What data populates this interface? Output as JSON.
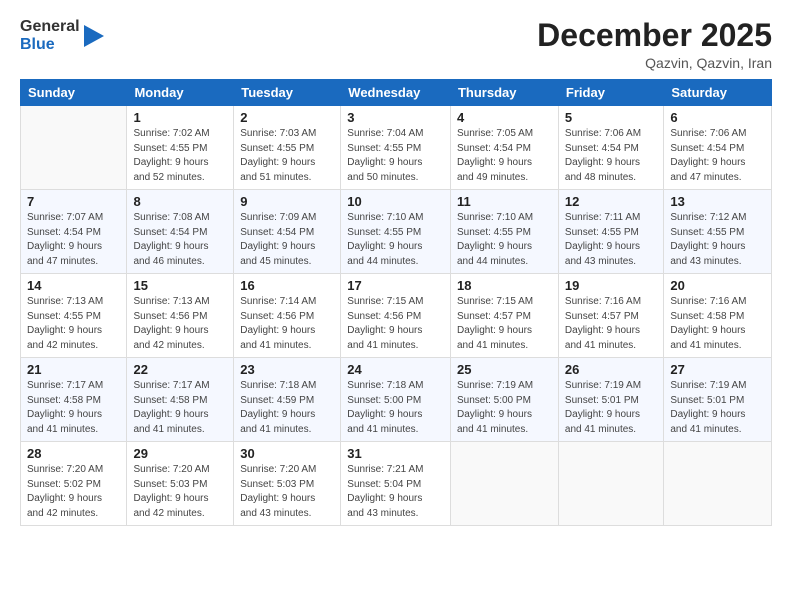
{
  "logo": {
    "general": "General",
    "blue": "Blue"
  },
  "header": {
    "month": "December 2025",
    "location": "Qazvin, Qazvin, Iran"
  },
  "weekdays": [
    "Sunday",
    "Monday",
    "Tuesday",
    "Wednesday",
    "Thursday",
    "Friday",
    "Saturday"
  ],
  "weeks": [
    [
      {
        "day": "",
        "info": ""
      },
      {
        "day": "1",
        "info": "Sunrise: 7:02 AM\nSunset: 4:55 PM\nDaylight: 9 hours\nand 52 minutes."
      },
      {
        "day": "2",
        "info": "Sunrise: 7:03 AM\nSunset: 4:55 PM\nDaylight: 9 hours\nand 51 minutes."
      },
      {
        "day": "3",
        "info": "Sunrise: 7:04 AM\nSunset: 4:55 PM\nDaylight: 9 hours\nand 50 minutes."
      },
      {
        "day": "4",
        "info": "Sunrise: 7:05 AM\nSunset: 4:54 PM\nDaylight: 9 hours\nand 49 minutes."
      },
      {
        "day": "5",
        "info": "Sunrise: 7:06 AM\nSunset: 4:54 PM\nDaylight: 9 hours\nand 48 minutes."
      },
      {
        "day": "6",
        "info": "Sunrise: 7:06 AM\nSunset: 4:54 PM\nDaylight: 9 hours\nand 47 minutes."
      }
    ],
    [
      {
        "day": "7",
        "info": "Sunrise: 7:07 AM\nSunset: 4:54 PM\nDaylight: 9 hours\nand 47 minutes."
      },
      {
        "day": "8",
        "info": "Sunrise: 7:08 AM\nSunset: 4:54 PM\nDaylight: 9 hours\nand 46 minutes."
      },
      {
        "day": "9",
        "info": "Sunrise: 7:09 AM\nSunset: 4:54 PM\nDaylight: 9 hours\nand 45 minutes."
      },
      {
        "day": "10",
        "info": "Sunrise: 7:10 AM\nSunset: 4:55 PM\nDaylight: 9 hours\nand 44 minutes."
      },
      {
        "day": "11",
        "info": "Sunrise: 7:10 AM\nSunset: 4:55 PM\nDaylight: 9 hours\nand 44 minutes."
      },
      {
        "day": "12",
        "info": "Sunrise: 7:11 AM\nSunset: 4:55 PM\nDaylight: 9 hours\nand 43 minutes."
      },
      {
        "day": "13",
        "info": "Sunrise: 7:12 AM\nSunset: 4:55 PM\nDaylight: 9 hours\nand 43 minutes."
      }
    ],
    [
      {
        "day": "14",
        "info": "Sunrise: 7:13 AM\nSunset: 4:55 PM\nDaylight: 9 hours\nand 42 minutes."
      },
      {
        "day": "15",
        "info": "Sunrise: 7:13 AM\nSunset: 4:56 PM\nDaylight: 9 hours\nand 42 minutes."
      },
      {
        "day": "16",
        "info": "Sunrise: 7:14 AM\nSunset: 4:56 PM\nDaylight: 9 hours\nand 41 minutes."
      },
      {
        "day": "17",
        "info": "Sunrise: 7:15 AM\nSunset: 4:56 PM\nDaylight: 9 hours\nand 41 minutes."
      },
      {
        "day": "18",
        "info": "Sunrise: 7:15 AM\nSunset: 4:57 PM\nDaylight: 9 hours\nand 41 minutes."
      },
      {
        "day": "19",
        "info": "Sunrise: 7:16 AM\nSunset: 4:57 PM\nDaylight: 9 hours\nand 41 minutes."
      },
      {
        "day": "20",
        "info": "Sunrise: 7:16 AM\nSunset: 4:58 PM\nDaylight: 9 hours\nand 41 minutes."
      }
    ],
    [
      {
        "day": "21",
        "info": "Sunrise: 7:17 AM\nSunset: 4:58 PM\nDaylight: 9 hours\nand 41 minutes."
      },
      {
        "day": "22",
        "info": "Sunrise: 7:17 AM\nSunset: 4:58 PM\nDaylight: 9 hours\nand 41 minutes."
      },
      {
        "day": "23",
        "info": "Sunrise: 7:18 AM\nSunset: 4:59 PM\nDaylight: 9 hours\nand 41 minutes."
      },
      {
        "day": "24",
        "info": "Sunrise: 7:18 AM\nSunset: 5:00 PM\nDaylight: 9 hours\nand 41 minutes."
      },
      {
        "day": "25",
        "info": "Sunrise: 7:19 AM\nSunset: 5:00 PM\nDaylight: 9 hours\nand 41 minutes."
      },
      {
        "day": "26",
        "info": "Sunrise: 7:19 AM\nSunset: 5:01 PM\nDaylight: 9 hours\nand 41 minutes."
      },
      {
        "day": "27",
        "info": "Sunrise: 7:19 AM\nSunset: 5:01 PM\nDaylight: 9 hours\nand 41 minutes."
      }
    ],
    [
      {
        "day": "28",
        "info": "Sunrise: 7:20 AM\nSunset: 5:02 PM\nDaylight: 9 hours\nand 42 minutes."
      },
      {
        "day": "29",
        "info": "Sunrise: 7:20 AM\nSunset: 5:03 PM\nDaylight: 9 hours\nand 42 minutes."
      },
      {
        "day": "30",
        "info": "Sunrise: 7:20 AM\nSunset: 5:03 PM\nDaylight: 9 hours\nand 43 minutes."
      },
      {
        "day": "31",
        "info": "Sunrise: 7:21 AM\nSunset: 5:04 PM\nDaylight: 9 hours\nand 43 minutes."
      },
      {
        "day": "",
        "info": ""
      },
      {
        "day": "",
        "info": ""
      },
      {
        "day": "",
        "info": ""
      }
    ]
  ]
}
